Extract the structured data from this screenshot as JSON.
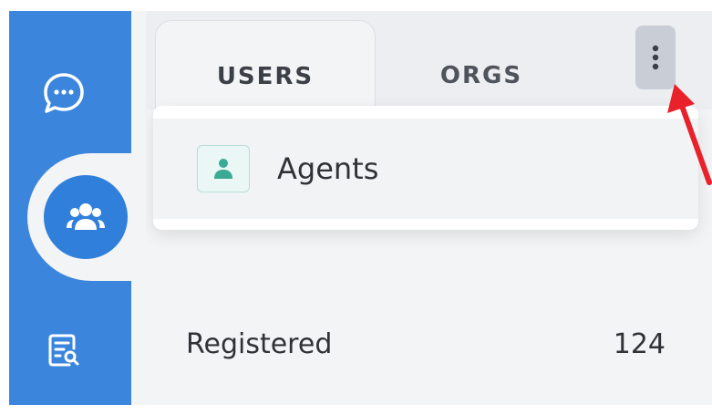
{
  "tabs": [
    {
      "label": "USERS",
      "active": true
    },
    {
      "label": "ORGS",
      "active": false
    }
  ],
  "more_menu": {
    "icon": "vertical-dots-icon",
    "items": [
      {
        "label": "Agents",
        "icon": "agent-person-icon"
      }
    ]
  },
  "stats": [
    {
      "label": "Registered",
      "value": "124"
    }
  ],
  "sidebar": {
    "items": [
      {
        "icon": "chat-bubble-icon",
        "active": false
      },
      {
        "icon": "users-group-icon",
        "active": true
      },
      {
        "icon": "document-search-icon",
        "active": false
      }
    ]
  },
  "colors": {
    "sidebar": "#3b86dc",
    "accent_teal": "#3aaa95",
    "annotation": "#e8212a"
  }
}
